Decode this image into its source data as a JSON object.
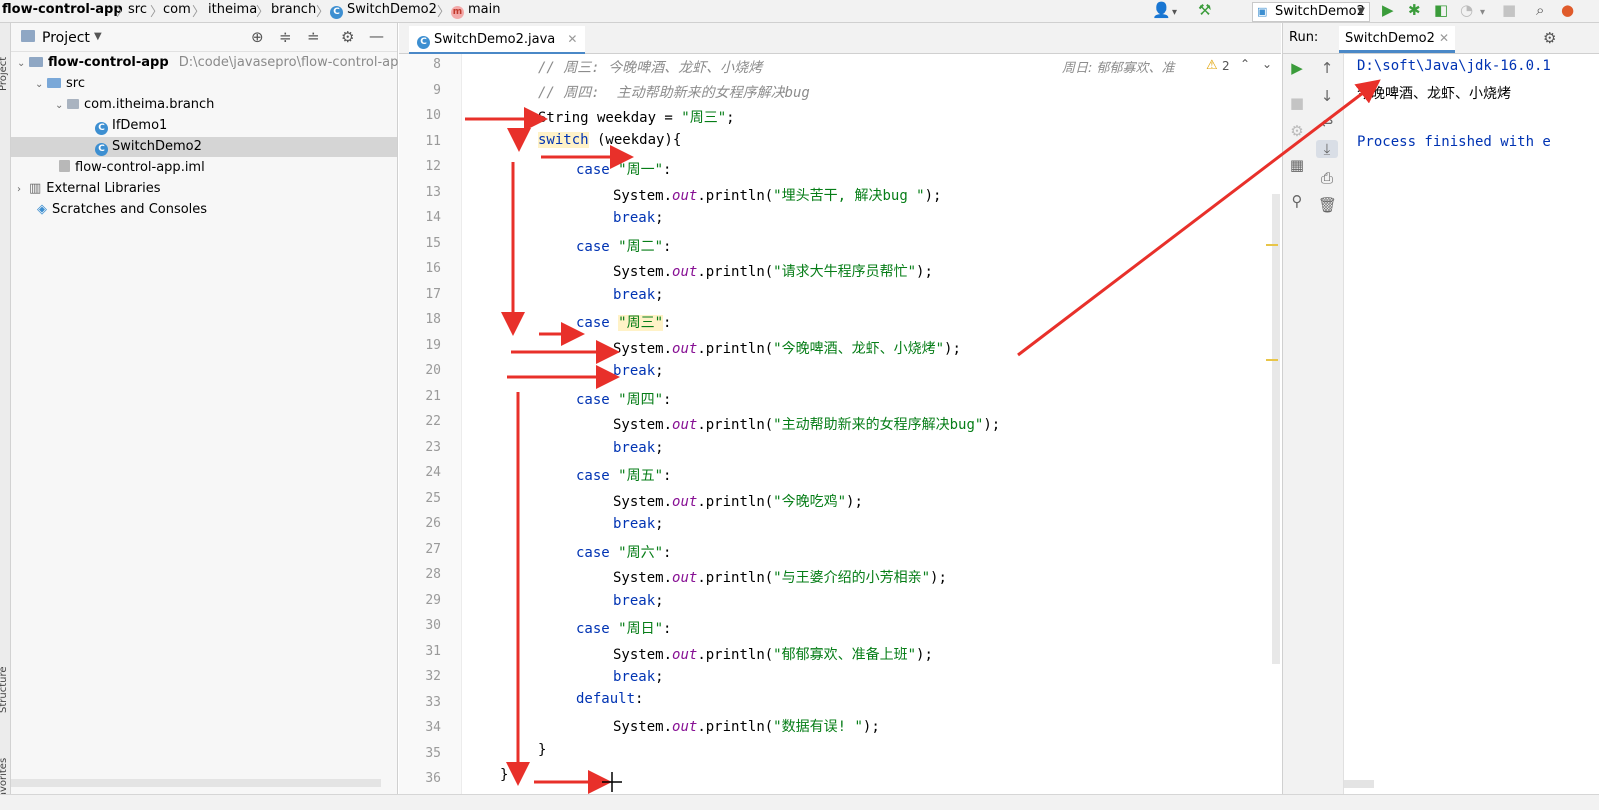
{
  "breadcrumb": {
    "project": "flow-control-app",
    "items": [
      "src",
      "com",
      "itheima",
      "branch",
      "SwitchDemo2",
      "main"
    ]
  },
  "toolbar": {
    "run_config": "SwitchDemo2"
  },
  "side_labels": {
    "project": "Project",
    "structure": "Structure",
    "favorites": "Favorites"
  },
  "project_panel": {
    "title": "Project",
    "tree": [
      {
        "label": "flow-control-app",
        "path": "D:\\code\\javasepro\\flow-control-ap"
      },
      {
        "label": "src"
      },
      {
        "label": "com.itheima.branch"
      },
      {
        "label": "IfDemo1"
      },
      {
        "label": "SwitchDemo2"
      },
      {
        "label": "flow-control-app.iml"
      },
      {
        "label": "External Libraries"
      },
      {
        "label": "Scratches and Consoles"
      }
    ]
  },
  "editor": {
    "tab": "SwitchDemo2.java",
    "inspection_count": "2",
    "line_numbers": [
      "8",
      "9",
      "10",
      "11",
      "12",
      "13",
      "14",
      "15",
      "16",
      "17",
      "18",
      "19",
      "20",
      "21",
      "22",
      "23",
      "24",
      "25",
      "26",
      "27",
      "28",
      "29",
      "30",
      "31",
      "32",
      "33",
      "34",
      "35",
      "36"
    ],
    "comment8": "// 周三: 今晚啤酒、龙虾、小烧烤",
    "comment8_right": "周日: 郁郁寡欢、准",
    "comment9": "// 周四:  主动帮助新来的女程序解决bug",
    "kw_switch": "switch",
    "kw_case": "case",
    "kw_break": "break",
    "kw_default": "default",
    "kw_string": "String",
    "decl_var": " weekday = ",
    "decl_val": "\"周三\"",
    "semicolon": ";",
    "switch_rest": " (weekday){",
    "colon": ":",
    "system": "System.",
    "out": "out",
    "println_open": ".println(",
    "println_close": ");",
    "cases": [
      "\"周一\"",
      "\"周二\"",
      "\"周三\"",
      "\"周四\"",
      "\"周五\"",
      "\"周六\"",
      "\"周日\""
    ],
    "messages": [
      "\"埋头苦干, 解决bug \"",
      "\"请求大牛程序员帮忙\"",
      "\"今晚啤酒、龙虾、小烧烤\"",
      "\"主动帮助新来的女程序解决bug\"",
      "\"今晚吃鸡\"",
      "\"与王婆介绍的小芳相亲\"",
      "\"郁郁寡欢、准备上班\"",
      "\"数据有误! \""
    ],
    "close_brace": "}"
  },
  "run_panel": {
    "label": "Run:",
    "tab": "SwitchDemo2",
    "console": [
      "D:\\soft\\Java\\jdk-16.0.1",
      "今晚啤酒、龙虾、小烧烤",
      "",
      "Process finished with e"
    ]
  },
  "colors": {
    "keyword": "#0033b3",
    "string": "#067d17",
    "field": "#871094",
    "comment": "#8c8c8c",
    "annotation": "#e8302a"
  },
  "icons": [
    "user-icon",
    "hammer-icon",
    "run-icon",
    "debug-icon",
    "coverage-icon",
    "profile-icon",
    "stop-icon",
    "search-icon",
    "target-icon",
    "expand-icon",
    "collapse-icon",
    "gear-icon",
    "minimize-icon",
    "rerun-icon",
    "scroll-up-icon",
    "scroll-down-icon",
    "wrap-icon",
    "print-icon",
    "trash-icon",
    "pin-icon",
    "warning-icon"
  ]
}
